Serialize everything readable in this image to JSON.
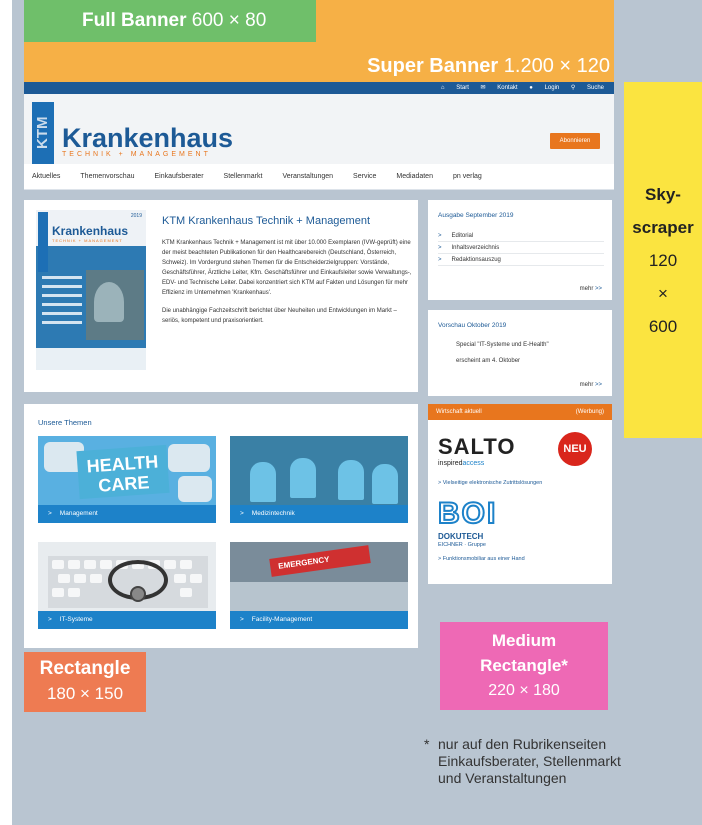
{
  "banners": {
    "full_banner": {
      "title": "Full Banner",
      "size": "600 × 80"
    },
    "super_banner": {
      "title": "Super Banner",
      "size": "1.200 × 120"
    },
    "skyscraper": {
      "title_line1": "Sky-",
      "title_line2": "scraper",
      "width": "120",
      "times": "×",
      "height": "600"
    },
    "rectangle": {
      "title": "Rectangle",
      "size": "180 × 150"
    },
    "medium_rectangle": {
      "title_line1": "Medium",
      "title_line2": "Rectangle*",
      "size": "220 × 180"
    }
  },
  "topbar": {
    "start": "Start",
    "kontakt": "Kontakt",
    "login": "Login",
    "suche": "Suche"
  },
  "header": {
    "logo_vertical": "KTM",
    "logo_title": "Krankenhaus",
    "logo_subtitle": "TECHNIK + MANAGEMENT",
    "subscribe": "Abonnieren"
  },
  "nav": [
    "Aktuelles",
    "Themenvorschau",
    "Einkaufsberater",
    "Stellenmarkt",
    "Veranstaltungen",
    "Service",
    "Mediadaten",
    "pn verlag"
  ],
  "main": {
    "title": "KTM Krankenhaus Technik + Management",
    "paragraph1": "KTM Krankenhaus Technik + Management ist mit über 10.000 Exemplaren (IVW-geprüft) eine der meist beachteten Publikationen für den Healthcarebereich (Deutschland, Österreich, Schweiz). Im Vordergrund stehen Themen für die Entscheiderzielgruppen: Vorstände, Geschäftsführer, Ärztliche Leiter, Kfm. Geschäftsführer und Einkaufsleiter sowie Verwaltungs-, EDV- und Technische Leiter. Dabei konzentriert sich KTM auf Fakten und Lösungen für mehr Effizienz im Unternehmen 'Krankenhaus'.",
    "paragraph2": "Die unabhängige Fachzeitschrift berichtet über Neuheiten und Entwicklungen im Markt – seriös, kompetent und praxisorientiert.",
    "magazine": {
      "title": "Krankenhaus",
      "subtitle": "TECHNIK + MANAGEMENT",
      "year": "2019"
    }
  },
  "issue": {
    "title": "Ausgabe September 2019",
    "items": [
      "Editorial",
      "Inhaltsverzeichnis",
      "Redaktionsauszug"
    ],
    "more": "mehr",
    "more_arrow": ">>"
  },
  "preview": {
    "title": "Vorschau Oktober 2019",
    "line1": "Special \"IT-Systeme und E-Health\"",
    "line2": "erscheint am 4. Oktober",
    "more": "mehr",
    "more_arrow": ">>"
  },
  "themes": {
    "title": "Unsere Themen",
    "arrow": ">",
    "health_care": "HEALTH CARE",
    "emergency": "EMERGENCY",
    "tiles": [
      "Management",
      "Medizintechnik",
      "IT-Systeme",
      "Facility-Management"
    ]
  },
  "ad": {
    "header": "Wirtschaft aktuell",
    "header_right": "(Werbung)",
    "salto": "SALTO",
    "salto_sub1": "inspired",
    "salto_sub2": "access",
    "neu": "NEU",
    "salto_link": "> Vielseitige elektronische Zutrittslösungen",
    "boi": "BOI",
    "boi_dokutech": "DOKUTECH",
    "boi_sub": "EICHNER · Gruppe",
    "boi_link": "> Funktionsmobiliar aus einer Hand"
  },
  "footnote": {
    "star": "*",
    "text_line1": "nur auf den Rubrikenseiten",
    "text_line2": "Einkaufsberater, Stellenmarkt",
    "text_line3": "und Veranstaltungen"
  },
  "colors": {
    "full_banner": "#6fbf6a",
    "super_banner": "#f6b046",
    "skyscraper": "#fbe440",
    "rectangle": "#ee7b52",
    "medium_rectangle": "#ee69b5",
    "brand_blue": "#1d5a96",
    "brand_orange": "#e8761e"
  }
}
